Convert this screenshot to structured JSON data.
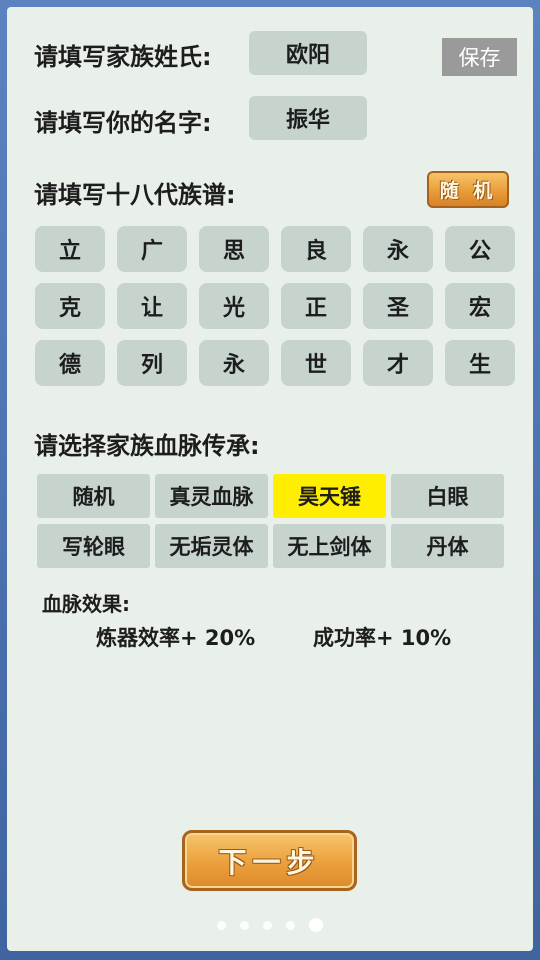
{
  "family": {
    "label": "请填写家族姓氏:",
    "value": "欧阳"
  },
  "given_name": {
    "label": "请填写你的名字:",
    "value": "振华"
  },
  "save_label": "保存",
  "genealogy": {
    "label": "请填写十八代族谱:",
    "random_label": "随 机",
    "chars": [
      "立",
      "广",
      "思",
      "良",
      "永",
      "公",
      "克",
      "让",
      "光",
      "正",
      "圣",
      "宏",
      "德",
      "列",
      "永",
      "世",
      "才",
      "生"
    ]
  },
  "bloodline": {
    "label": "请选择家族血脉传承:",
    "options": [
      "随机",
      "真灵血脉",
      "昊天锤",
      "白眼",
      "写轮眼",
      "无垢灵体",
      "无上剑体",
      "丹体"
    ],
    "selected": "昊天锤"
  },
  "effect": {
    "title": "血脉效果:",
    "items": [
      "炼器效率+ 20%",
      "成功率+ 10%"
    ]
  },
  "next_label": "下一步",
  "pager": {
    "total": 5,
    "active": 5
  }
}
